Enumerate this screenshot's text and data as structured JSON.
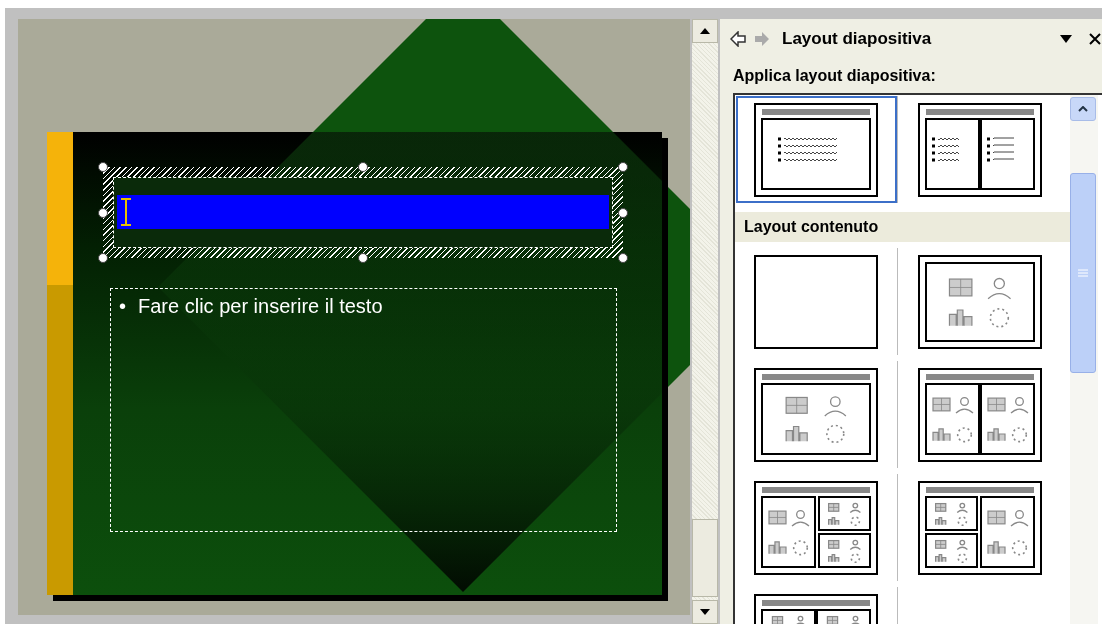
{
  "editor": {
    "slide": {
      "title_placeholder": {
        "selected": true
      },
      "body_placeholder": {
        "bullet": "•",
        "text": "Fare clic per inserire il testo"
      }
    }
  },
  "task_pane": {
    "title": "Layout diapositiva",
    "heading": "Applica layout diapositiva:",
    "sections": [
      {
        "items": [
          {
            "kind": "title-text",
            "selected": true
          },
          {
            "kind": "title-two-text",
            "selected": false
          }
        ]
      },
      {
        "header": "Layout contenuto",
        "items": [
          {
            "kind": "blank",
            "selected": false
          },
          {
            "kind": "content",
            "selected": false
          },
          {
            "kind": "title-content",
            "selected": false
          },
          {
            "kind": "title-two-content",
            "selected": false
          },
          {
            "kind": "title-content-two-small",
            "selected": false
          },
          {
            "kind": "title-two-small-content",
            "selected": false
          },
          {
            "kind": "title-four-content",
            "selected": false
          }
        ]
      }
    ]
  }
}
